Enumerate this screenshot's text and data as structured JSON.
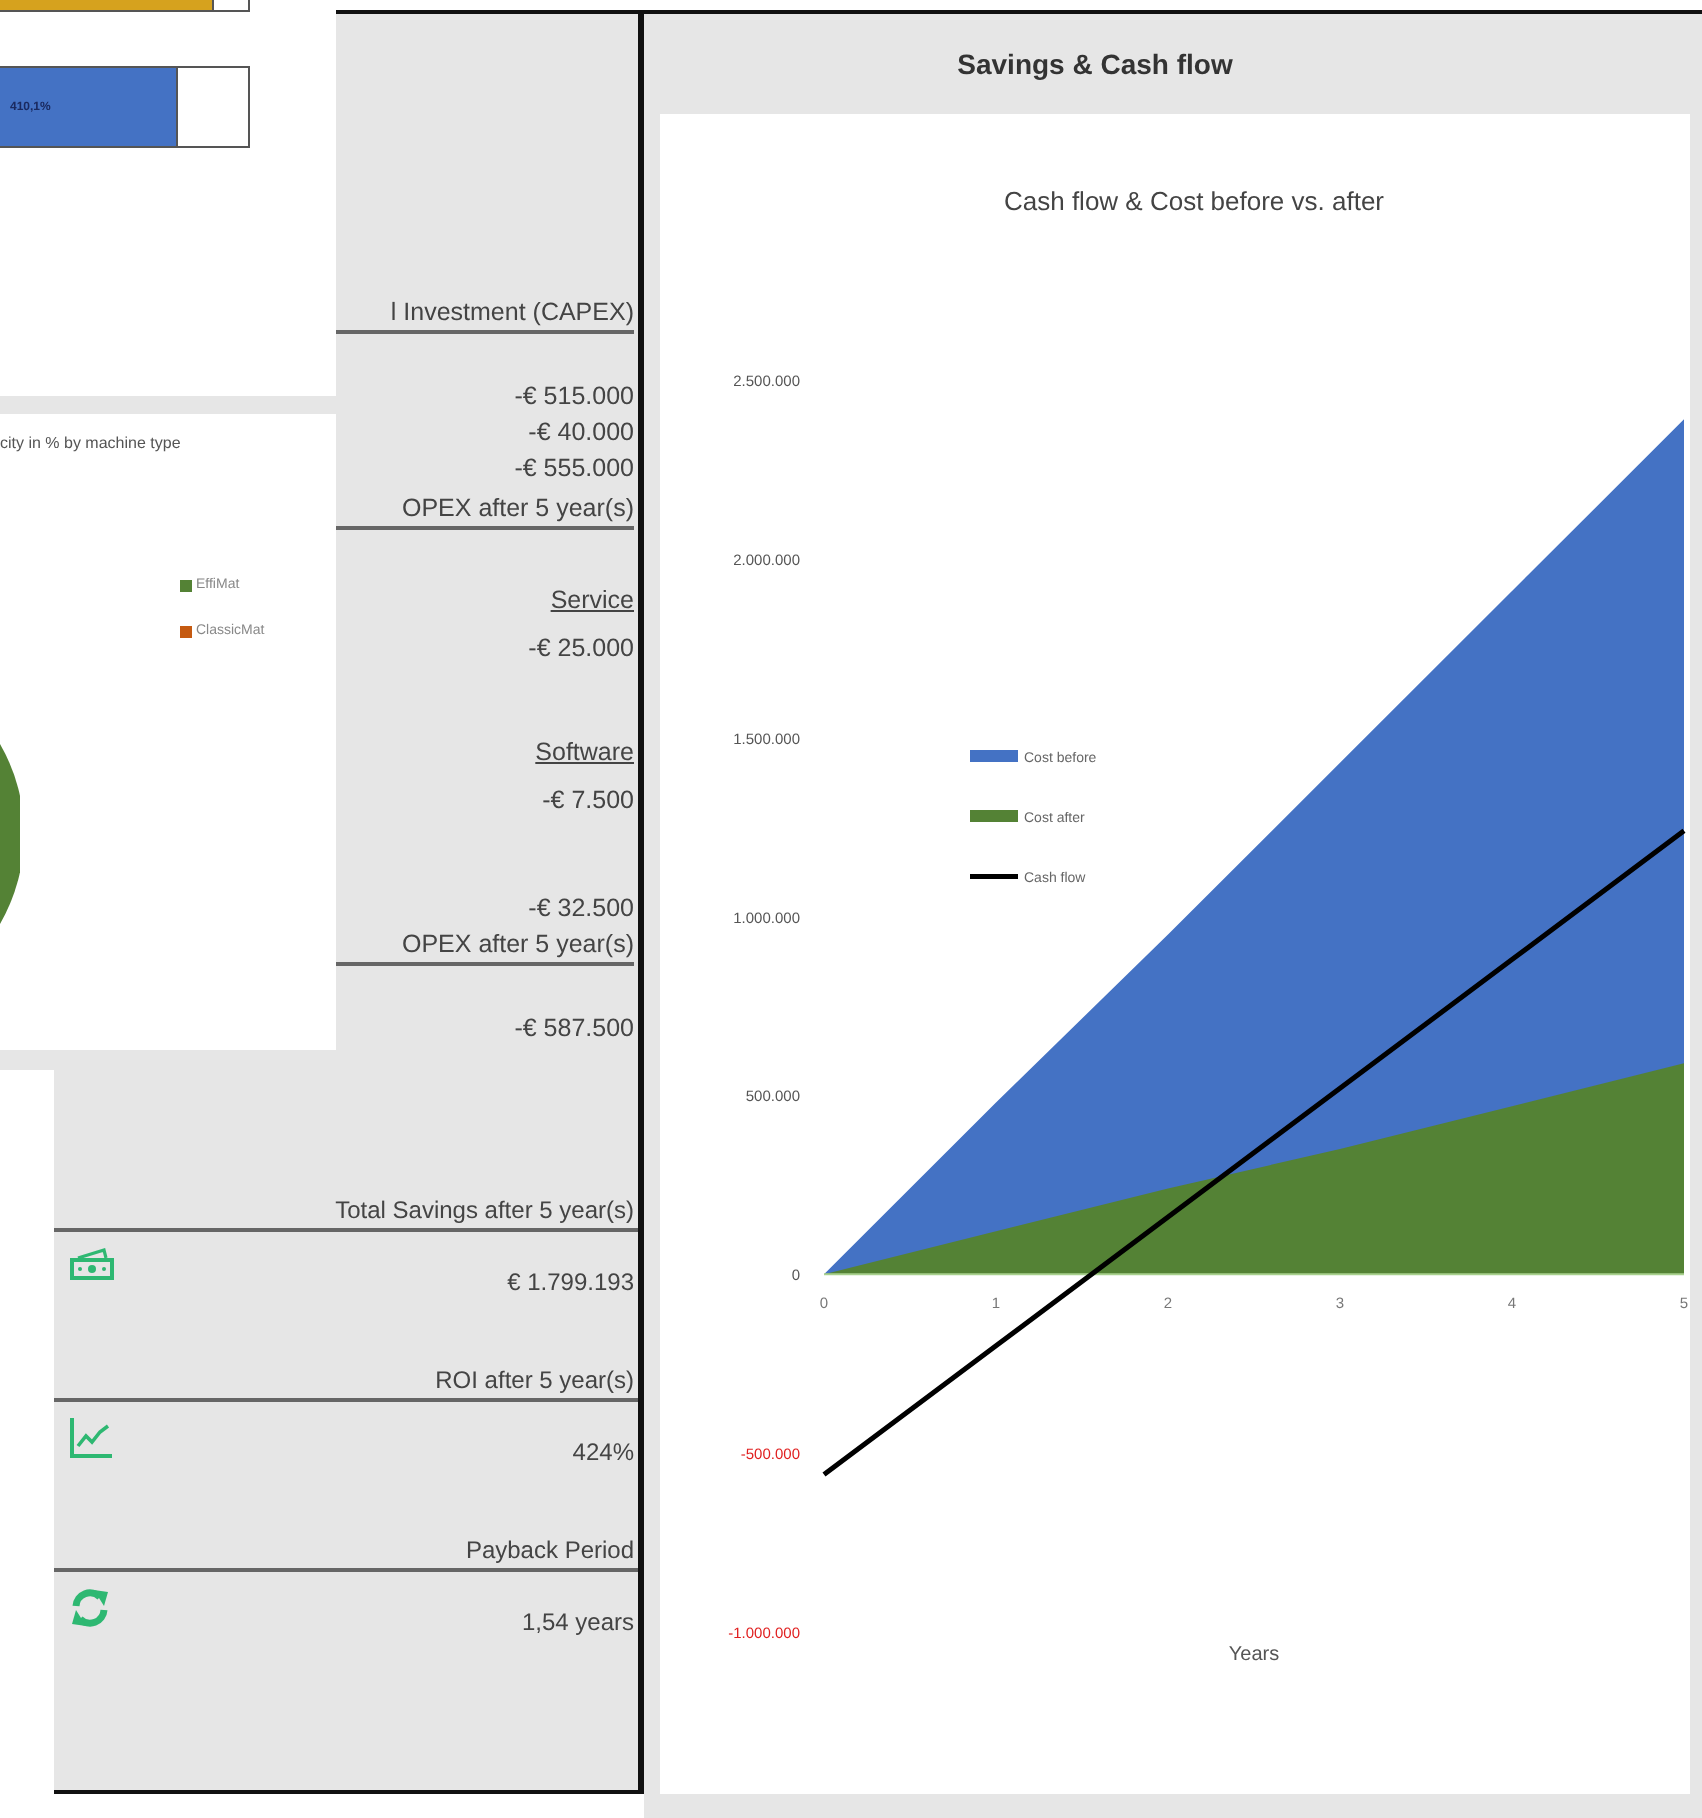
{
  "top_chart": {
    "bars": [
      {
        "color": "#d6a21e",
        "level": 0.86
      },
      {
        "color": "#4472c4",
        "level": 0.72,
        "label": "410,1%"
      }
    ]
  },
  "pie_chart": {
    "title": "city in % by machine type",
    "legend": [
      {
        "label": "EffiMat",
        "color": "#548235"
      },
      {
        "label": "ClassicMat",
        "color": "#c55a11"
      }
    ]
  },
  "cost_breakdown": [
    {
      "kind": "heading",
      "text": "l Investment (CAPEX)"
    },
    {
      "kind": "value",
      "text": "-€ 515.000"
    },
    {
      "kind": "value",
      "text": "-€ 40.000"
    },
    {
      "kind": "value",
      "text": "-€ 555.000"
    },
    {
      "kind": "heading",
      "text": "OPEX after 5 year(s)"
    },
    {
      "kind": "subheading",
      "text": "Service"
    },
    {
      "kind": "value",
      "text": "-€ 25.000"
    },
    {
      "kind": "subheading",
      "text": "Software"
    },
    {
      "kind": "value",
      "text": "-€ 7.500"
    },
    {
      "kind": "total",
      "text": "-€ 32.500"
    },
    {
      "kind": "heading",
      "text": "OPEX after 5 year(s)"
    },
    {
      "kind": "total",
      "text": "-€ 587.500"
    }
  ],
  "kpis": [
    {
      "label": "Total Savings after 5 year(s)",
      "value": "€ 1.799.193"
    },
    {
      "label": "ROI after 5 year(s)",
      "value": "424%"
    },
    {
      "label": "Payback Period",
      "value": "1,54 years"
    }
  ],
  "savings_panel": {
    "title": "Savings & Cash flow",
    "chart_data": {
      "type": "area",
      "title": "Cash flow & Cost before vs. after",
      "xlabel": "Years",
      "x": [
        0,
        1,
        2,
        3,
        4,
        5
      ],
      "series": [
        {
          "name": "Cost before",
          "color": "#4472c4",
          "type": "area",
          "values": [
            0,
            480000,
            950000,
            1430000,
            1910000,
            2390000
          ]
        },
        {
          "name": "Cost after",
          "color": "#548235",
          "type": "area",
          "values": [
            0,
            120000,
            240000,
            350000,
            470000,
            590000
          ]
        },
        {
          "name": "Cash flow",
          "color": "#000000",
          "type": "line",
          "values": [
            -560000,
            -200000,
            160000,
            520000,
            880000,
            1240000
          ]
        }
      ],
      "legend": true,
      "xticks": [
        0,
        1,
        2,
        3,
        4,
        5
      ],
      "xlim": [
        0,
        5
      ],
      "ylim": [
        -1000000,
        2500000
      ],
      "yticks": [
        {
          "value": -1000000,
          "label": "-1.000.000"
        },
        {
          "value": -500000,
          "label": "-500.000"
        },
        {
          "value": 0,
          "label": "0"
        },
        {
          "value": 500000,
          "label": "500.000"
        },
        {
          "value": 1000000,
          "label": "1.000.000"
        },
        {
          "value": 1500000,
          "label": "1.500.000"
        },
        {
          "value": 2000000,
          "label": "2.000.000"
        },
        {
          "value": 2500000,
          "label": "2.500.000"
        }
      ]
    }
  }
}
